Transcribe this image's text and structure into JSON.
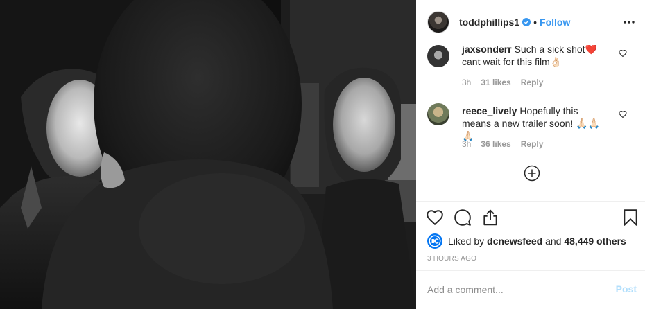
{
  "post": {
    "image_alt": "Black and white photo of a man applying white face makeup in a mirror"
  },
  "header": {
    "username": "toddphillips1",
    "separator": "•",
    "follow_label": "Follow"
  },
  "comments": [
    {
      "username": "jaxsonderr",
      "text": "Such a sick shot❤️ cant wait for this film👌🏻",
      "time": "3h",
      "likes": "31 likes",
      "reply": "Reply"
    },
    {
      "username": "reece_lively",
      "text": "Hopefully this means a new trailer soon! 🙏🏻🙏🏻🙏🏻",
      "time": "3h",
      "likes": "36 likes",
      "reply": "Reply"
    }
  ],
  "likes": {
    "prefix": "Liked by",
    "user": "dcnewsfeed",
    "conjunction": "and",
    "count": "48,449 others"
  },
  "timestamp": "3 HOURS AGO",
  "add_comment": {
    "placeholder": "Add a comment...",
    "post_label": "Post"
  },
  "colors": {
    "accent": "#3897f0",
    "post_disabled": "#b2dffc",
    "muted": "#999999"
  }
}
